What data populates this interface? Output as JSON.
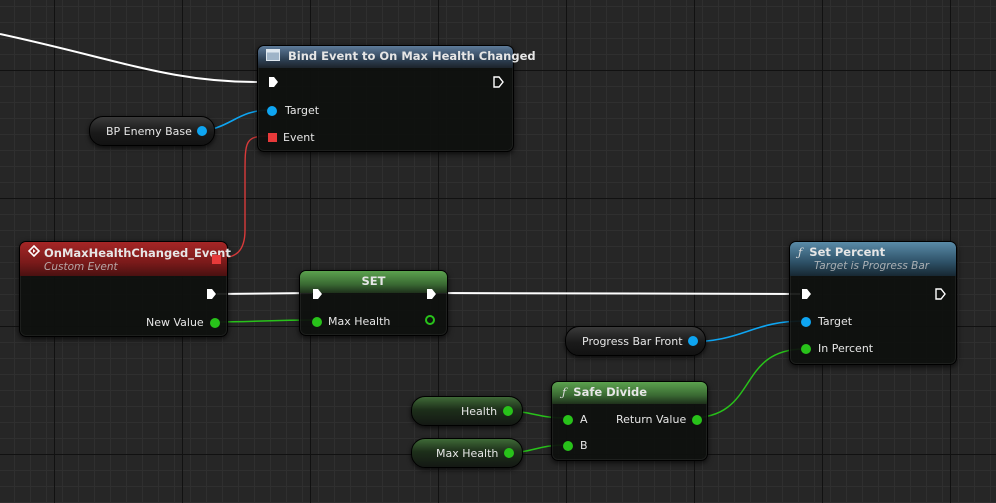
{
  "nodes": {
    "bind_event": {
      "title": "Bind Event to On Max Health Changed",
      "pins": {
        "target": "Target",
        "event": "Event"
      }
    },
    "bp_enemy_base": {
      "label": "BP Enemy Base"
    },
    "custom_event": {
      "title": "OnMaxHealthChanged_Event",
      "subtitle": "Custom Event",
      "pins": {
        "new_value": "New Value"
      }
    },
    "set_node": {
      "title": "SET",
      "pins": {
        "max_health": "Max Health"
      }
    },
    "set_percent": {
      "title": "Set Percent",
      "subtitle": "Target is Progress Bar",
      "pins": {
        "target": "Target",
        "in_percent": "In Percent"
      }
    },
    "progress_bar_front": {
      "label": "Progress Bar Front"
    },
    "safe_divide": {
      "title": "Safe Divide",
      "pins": {
        "a": "A",
        "b": "B",
        "return_value": "Return Value"
      }
    },
    "health_var": {
      "label": "Health"
    },
    "max_health_var": {
      "label": "Max Health"
    }
  },
  "colors": {
    "exec_wire": "#ffffff",
    "object_pin": "#0ea5f2",
    "float_pin": "#28c21a",
    "delegate_pin": "#e83a3a"
  },
  "icons": {
    "bind_event": "event-dispatcher-icon",
    "custom_event": "custom-event-diamond-icon",
    "function": "function-icon"
  }
}
